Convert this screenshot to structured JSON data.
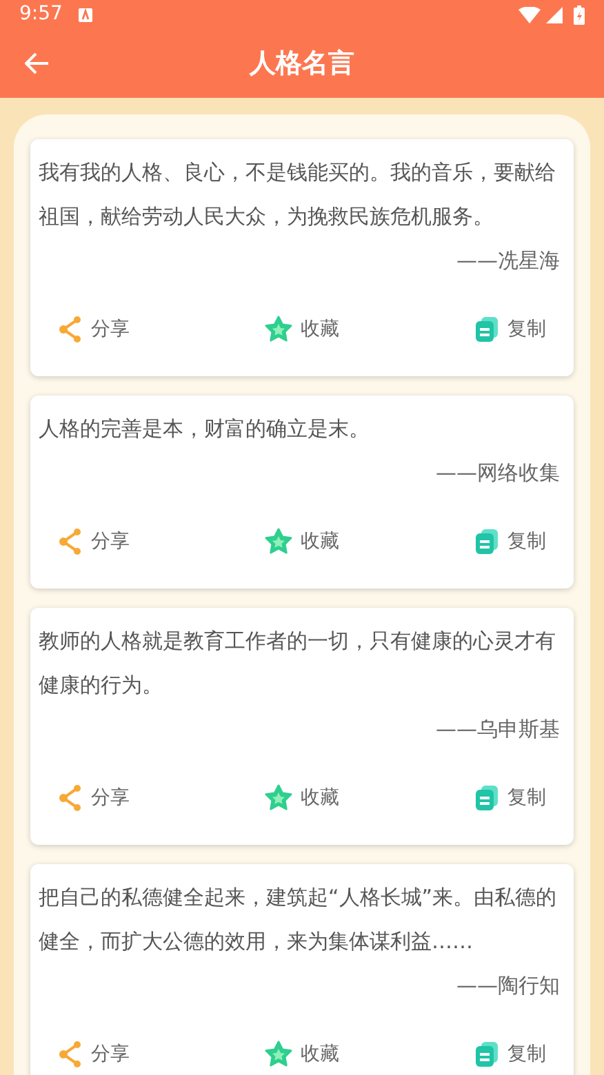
{
  "status_bar": {
    "time": "9:57"
  },
  "app_bar": {
    "title": "人格名言"
  },
  "quotes": [
    {
      "text": "我有我的人格、良心，不是钱能买的。我的音乐，要献给祖国，献给劳动人民大众，为挽救民族危机服务。",
      "author": "——冼星海",
      "actions": [
        "分享",
        "收藏",
        "复制"
      ]
    },
    {
      "text": "人格的完善是本，财富的确立是末。",
      "author": "——网络收集",
      "actions": [
        "分享",
        "收藏",
        "复制"
      ]
    },
    {
      "text": "教师的人格就是教育工作者的一切，只有健康的心灵才有健康的行为。",
      "author": "——乌申斯基",
      "actions": [
        "分享",
        "收藏",
        "复制"
      ]
    },
    {
      "text": "把自己的私德健全起来，建筑起“人格长城”来。由私德的健全，而扩大公德的效用，来为集体谋利益……",
      "author": "——陶行知",
      "actions": [
        "分享",
        "收藏",
        "复制"
      ]
    }
  ]
}
